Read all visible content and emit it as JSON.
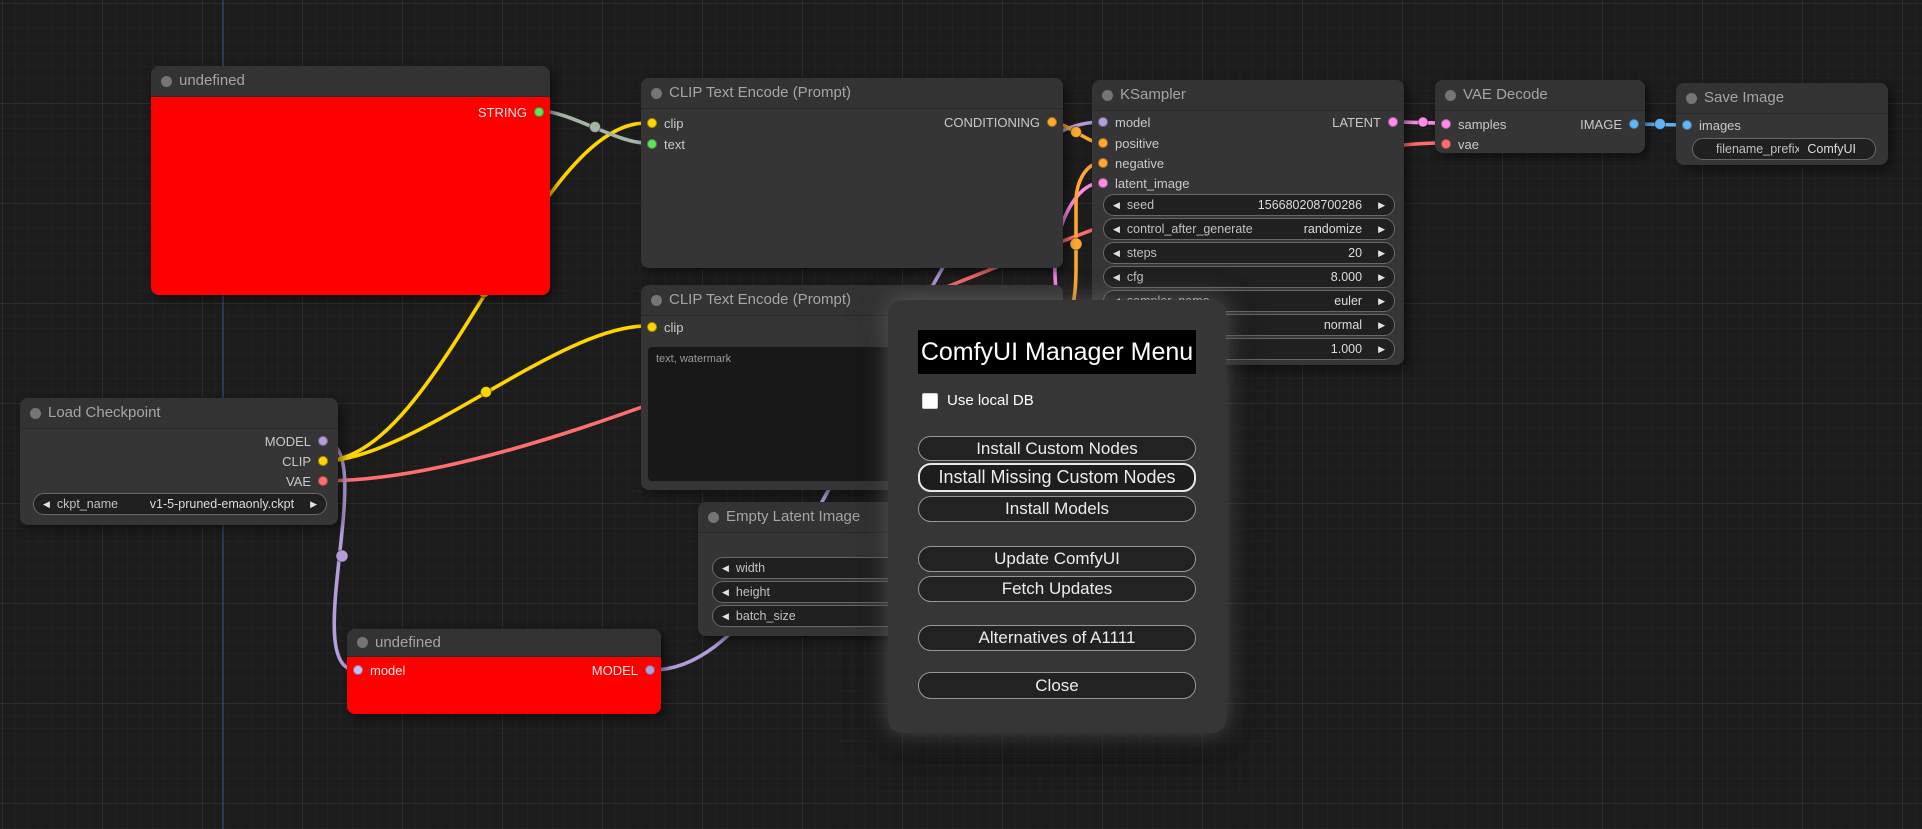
{
  "app_title": "ComfyUI",
  "colors": {
    "canvas_bg": "#1C1C1C",
    "node_bg": "#353535",
    "node_title_bg": "#333333",
    "error_node_bg": "#FF0000",
    "dialog_bg": "#363636",
    "dialog_title_bg": "#000000",
    "port_model": "#B39DDB",
    "port_clip": "#FFD500",
    "port_vae": "#FF6E6E",
    "port_conditioning": "#FFA931",
    "port_latent": "#FF8CE9",
    "port_image": "#64B5F6",
    "port_string": "#63E05C",
    "link_string_text": "#A5B5A5"
  },
  "nodes": {
    "undefined_top": {
      "title": "undefined",
      "outputs": [
        {
          "label": "STRING"
        }
      ]
    },
    "clip_text_encode_top": {
      "title": "CLIP Text Encode (Prompt)",
      "inputs": [
        {
          "label": "clip"
        },
        {
          "label": "text"
        }
      ],
      "outputs": [
        {
          "label": "CONDITIONING"
        }
      ]
    },
    "clip_text_encode_bottom": {
      "title": "CLIP Text Encode (Prompt)",
      "inputs": [
        {
          "label": "clip"
        }
      ],
      "prompt_text": "text, watermark"
    },
    "ksampler": {
      "title": "KSampler",
      "inputs": [
        {
          "label": "model"
        },
        {
          "label": "positive"
        },
        {
          "label": "negative"
        },
        {
          "label": "latent_image"
        }
      ],
      "outputs": [
        {
          "label": "LATENT"
        }
      ],
      "widgets": [
        {
          "label": "seed",
          "value": "156680208700286"
        },
        {
          "label": "control_after_generate",
          "value": "randomize"
        },
        {
          "label": "steps",
          "value": "20"
        },
        {
          "label": "cfg",
          "value": "8.000"
        },
        {
          "label": "sampler_name",
          "value": "euler"
        },
        {
          "label": "",
          "value": "normal"
        },
        {
          "label": "",
          "value": "1.000"
        }
      ]
    },
    "load_checkpoint": {
      "title": "Load Checkpoint",
      "outputs": [
        {
          "label": "MODEL"
        },
        {
          "label": "CLIP"
        },
        {
          "label": "VAE"
        }
      ],
      "widgets": [
        {
          "label": "ckpt_name",
          "value": "v1-5-pruned-emaonly.ckpt"
        }
      ]
    },
    "empty_latent_image": {
      "title": "Empty Latent Image",
      "widgets": [
        {
          "label": "width",
          "value": ""
        },
        {
          "label": "height",
          "value": ""
        },
        {
          "label": "batch_size",
          "value": ""
        }
      ]
    },
    "vae_decode": {
      "title": "VAE Decode",
      "inputs": [
        {
          "label": "samples"
        },
        {
          "label": "vae"
        }
      ],
      "outputs": [
        {
          "label": "IMAGE"
        }
      ]
    },
    "save_image": {
      "title": "Save Image",
      "inputs": [
        {
          "label": "images"
        }
      ],
      "widgets": [
        {
          "label": "filename_prefix",
          "value": "ComfyUI"
        }
      ]
    },
    "undefined_bottom": {
      "title": "undefined",
      "inputs": [
        {
          "label": "model"
        }
      ],
      "outputs": [
        {
          "label": "MODEL"
        }
      ]
    }
  },
  "manager_menu": {
    "title": "ComfyUI Manager Menu",
    "use_local_db_label": "Use local DB",
    "use_local_db_checked": false,
    "buttons": [
      "Install Custom Nodes",
      "Install Missing Custom Nodes",
      "Install Models",
      "Update ComfyUI",
      "Fetch Updates",
      "Alternatives of A1111",
      "Close"
    ]
  }
}
